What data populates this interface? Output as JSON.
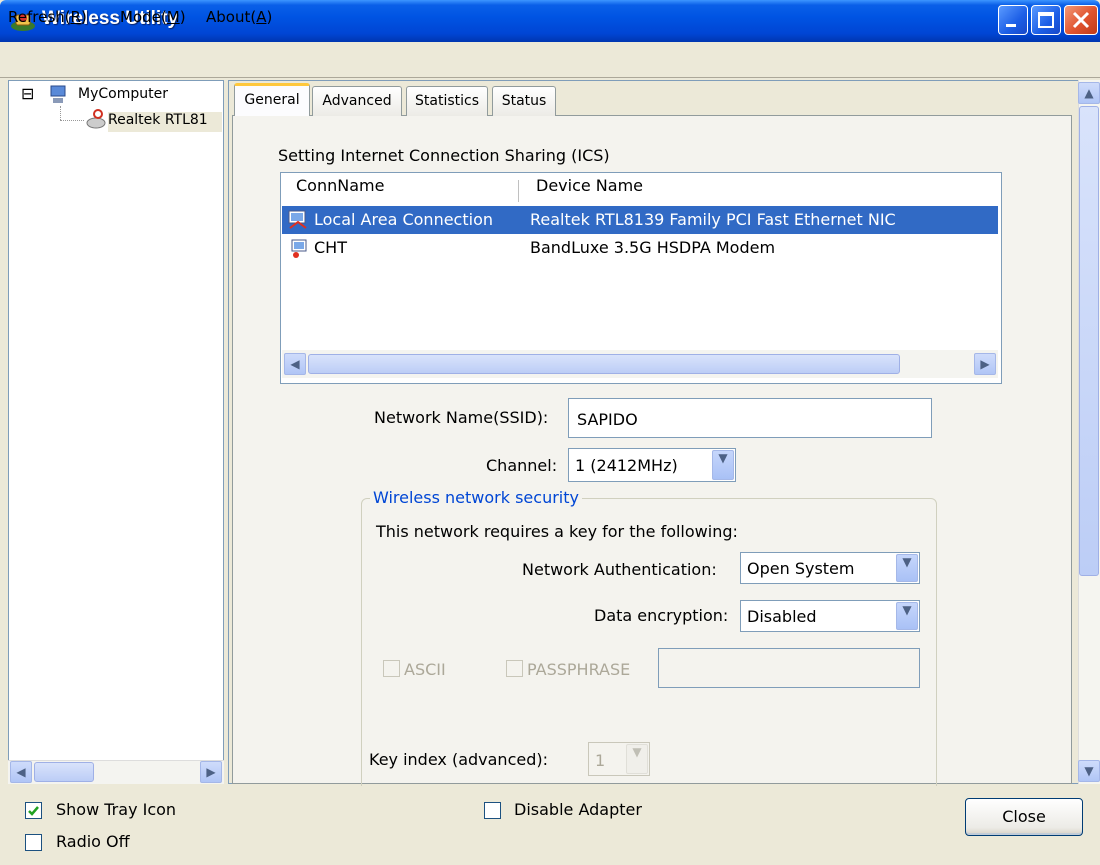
{
  "window": {
    "title": "Wireless Utility"
  },
  "menu": [
    {
      "label": "Refresh(",
      "key": "R",
      "suffix": ")"
    },
    {
      "label": "Mode(",
      "key": "M",
      "suffix": ")"
    },
    {
      "label": "About(",
      "key": "A",
      "suffix": ")"
    }
  ],
  "tree": {
    "expander": "⊟",
    "root": "MyComputer",
    "child": "Realtek RTL81"
  },
  "tabs": [
    {
      "label": "General",
      "active": true
    },
    {
      "label": "Advanced",
      "active": false
    },
    {
      "label": "Statistics",
      "active": false
    },
    {
      "label": "Status",
      "active": false
    }
  ],
  "ics": {
    "heading": "Setting Internet Connection Sharing (ICS)",
    "columns": [
      "ConnName",
      "Device Name"
    ],
    "rows": [
      {
        "conn": "Local Area Connection",
        "device": "Realtek RTL8139 Family PCI Fast Ethernet NIC",
        "selected": true
      },
      {
        "conn": "CHT",
        "device": "BandLuxe 3.5G HSDPA Modem",
        "selected": false
      }
    ]
  },
  "network": {
    "ssid_label": "Network Name(SSID):",
    "ssid_value": "SAPIDO",
    "channel_label": "Channel:",
    "channel_value": "1  (2412MHz)"
  },
  "security": {
    "legend": "Wireless network security",
    "intro": "This network requires a key for the following:",
    "auth_label": "Network Authentication:",
    "auth_value": "Open System",
    "enc_label": "Data encryption:",
    "enc_value": "Disabled",
    "ascii_label": "ASCII",
    "passphrase_label": "PASSPHRASE",
    "key_index_label": "Key index (advanced):",
    "key_index_value": "1"
  },
  "bottom": {
    "show_tray_label": "Show Tray Icon",
    "show_tray_checked": true,
    "radio_off_label": "Radio Off",
    "radio_off_checked": false,
    "disable_adapter_label": "Disable Adapter",
    "disable_adapter_checked": false,
    "close_label": "Close"
  },
  "colors": {
    "titlebar": "#0054e3",
    "selection": "#316ac5",
    "group_legend": "#0046d5"
  },
  "icons": {
    "app": "wireless-utility-icon",
    "computer": "computer-icon",
    "adapter": "network-adapter-icon",
    "lan": "lan-connection-icon",
    "modem": "dialup-connection-icon"
  }
}
